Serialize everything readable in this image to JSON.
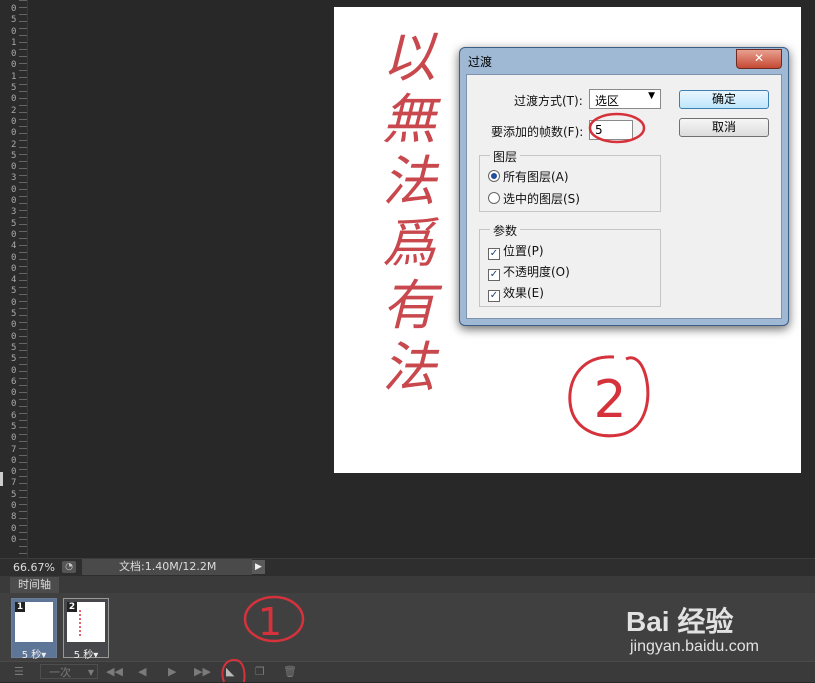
{
  "ruler": {
    "digits": "050100150200250300350400450500550600650700750800"
  },
  "canvas": {
    "calligraphy": [
      "以",
      "無",
      "法",
      "爲",
      "有",
      "法"
    ],
    "annotation_circle": "2"
  },
  "dialog": {
    "title": "过渡",
    "close_label": "✕",
    "tween_with_label": "过渡方式(T):",
    "tween_with_value": "选区",
    "frames_to_add_label": "要添加的帧数(F):",
    "frames_to_add_value": "5",
    "ok_label": "确定",
    "cancel_label": "取消",
    "layers_group": {
      "legend": "图层",
      "options": [
        {
          "label": "所有图层(A)",
          "selected": true
        },
        {
          "label": "选中的图层(S)",
          "selected": false
        }
      ]
    },
    "params_group": {
      "legend": "参数",
      "options": [
        {
          "label": "位置(P)",
          "checked": true
        },
        {
          "label": "不透明度(O)",
          "checked": true
        },
        {
          "label": "效果(E)",
          "checked": true
        }
      ]
    }
  },
  "status": {
    "zoom": "66.67%",
    "doc_info": "文档:1.40M/12.2M"
  },
  "timeline": {
    "tab_label": "时间轴",
    "frames": [
      {
        "number": "1",
        "duration": "5 秒▾"
      },
      {
        "number": "2",
        "duration": "5 秒▾"
      }
    ],
    "loop_label": "一次",
    "annotation_circle": "1"
  },
  "watermark": {
    "brand": "Bai 经验",
    "url": "jingyan.baidu.com"
  },
  "colors": {
    "annotation_red": "#d6323c",
    "workspace_bg": "#282828",
    "dialog_frame": "#9fb9d4"
  }
}
